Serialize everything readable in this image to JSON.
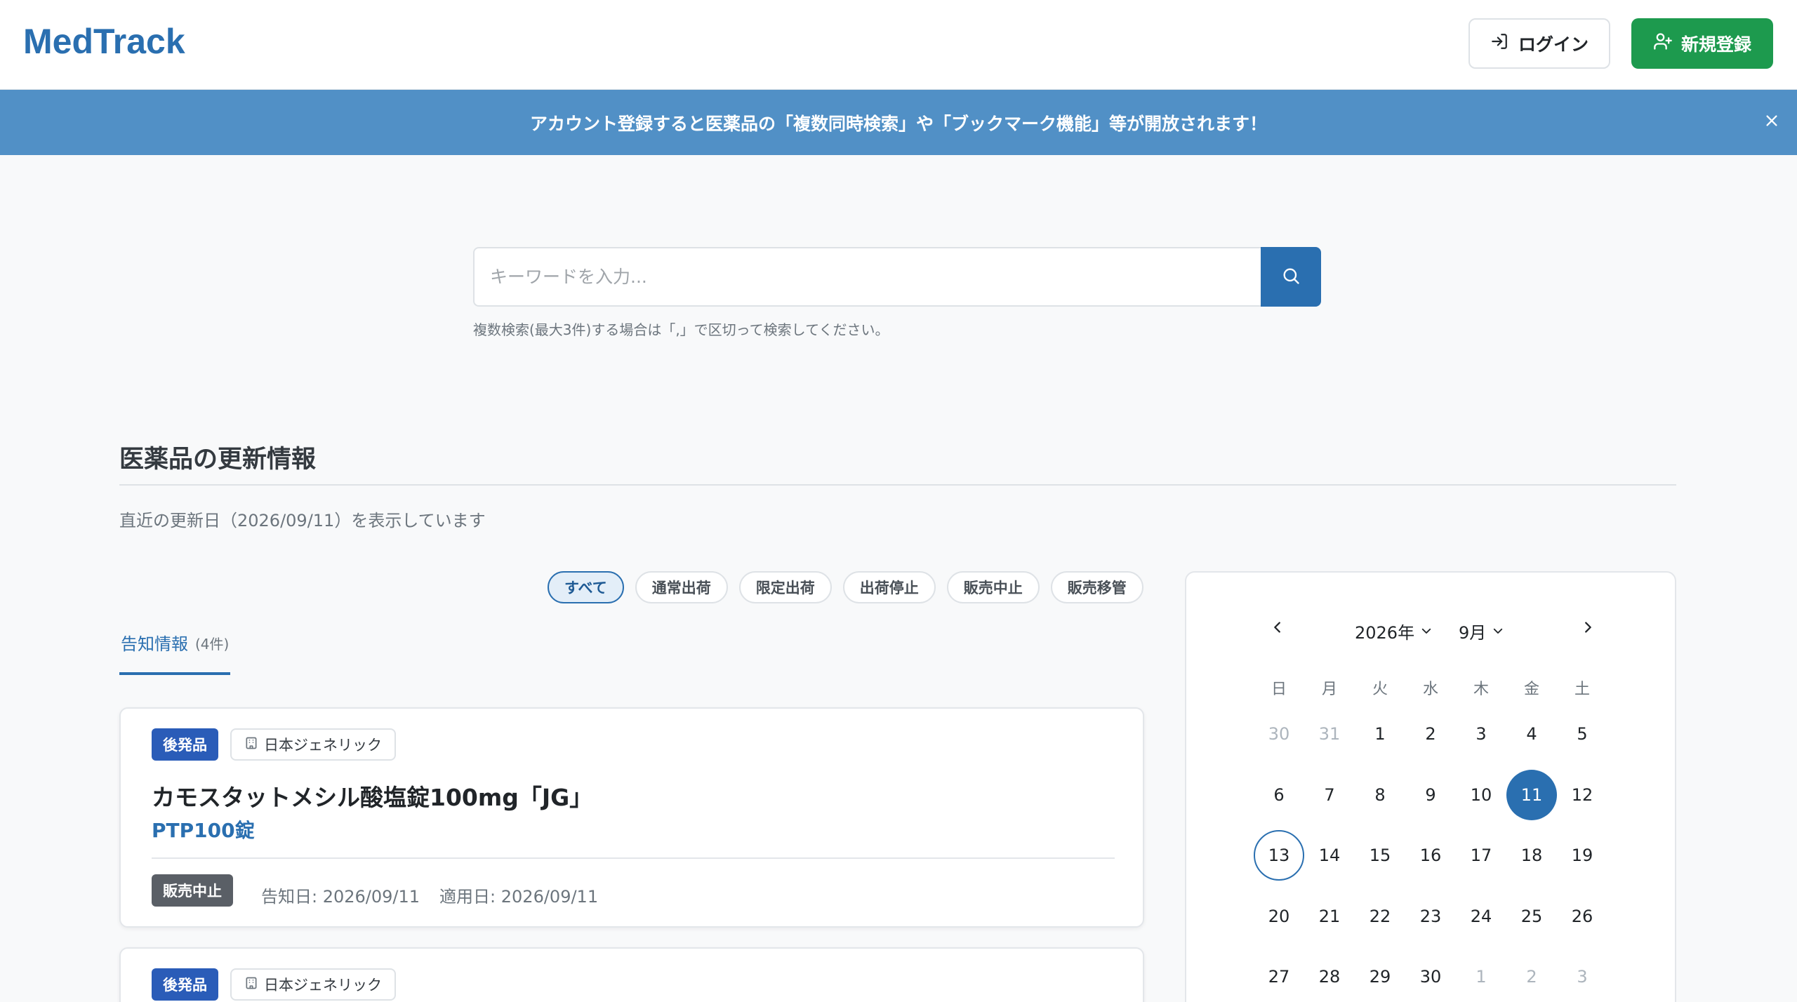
{
  "header": {
    "logo": "MedTrack",
    "login_label": "ログイン",
    "signup_label": "新規登録"
  },
  "banner": {
    "text": "アカウント登録すると医薬品の「複数同時検索」や「ブックマーク機能」等が開放されます！"
  },
  "search": {
    "placeholder": "キーワードを入力...",
    "hint": "複数検索(最大3件)する場合は「,」で区切って検索してください。"
  },
  "section": {
    "title": "医薬品の更新情報",
    "subtitle": "直近の更新日（2026/09/11）を表示しています"
  },
  "filters": [
    "すべて",
    "通常出荷",
    "限定出荷",
    "出荷停止",
    "販売中止",
    "販売移管"
  ],
  "tab": {
    "label": "告知情報",
    "count": "(4件)"
  },
  "cards": [
    {
      "type_badge": "後発品",
      "maker": "日本ジェネリック",
      "name": "カモスタットメシル酸塩錠100mg「JG」",
      "package": "PTP100錠",
      "status": "販売中止",
      "notice_date": "告知日: 2026/09/11",
      "apply_date": "適用日: 2026/09/11"
    },
    {
      "type_badge": "後発品",
      "maker": "日本ジェネリック"
    }
  ],
  "calendar": {
    "year": "2026年",
    "month": "9月",
    "weekdays": [
      "日",
      "月",
      "火",
      "水",
      "木",
      "金",
      "土"
    ],
    "weeks": [
      [
        "30",
        "31",
        "1",
        "2",
        "3",
        "4",
        "5"
      ],
      [
        "6",
        "7",
        "8",
        "9",
        "10",
        "11",
        "12"
      ],
      [
        "13",
        "14",
        "15",
        "16",
        "17",
        "18",
        "19"
      ],
      [
        "20",
        "21",
        "22",
        "23",
        "24",
        "25",
        "26"
      ],
      [
        "27",
        "28",
        "29",
        "30",
        "1",
        "2",
        "3"
      ]
    ],
    "selected_day": "11",
    "today_day": "13"
  },
  "colors": {
    "brand": "#2a6fb0",
    "signup": "#1d9a4e",
    "banner": "#5190c6",
    "status_dark": "#5a5f66"
  }
}
